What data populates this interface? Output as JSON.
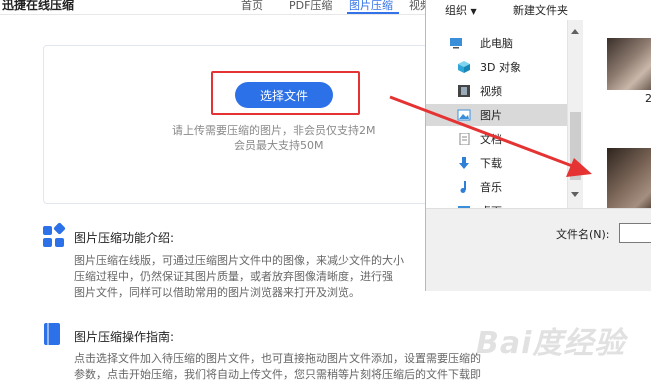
{
  "site": {
    "brand": "迅捷在线压缩",
    "nav": [
      "首页",
      "PDF压缩",
      "图片压缩",
      "视频"
    ],
    "active_nav": "图片压缩"
  },
  "upload": {
    "button_label": "选择文件",
    "hint_line1": "请上传需要压缩的图片，非会员仅支持2M",
    "hint_line2": "会员最大支持50M"
  },
  "sections": [
    {
      "title": "图片压缩功能介绍:",
      "lines": [
        "图片压缩在线版，可通过压缩图片文件中的图像，来减少文件的大小",
        "压缩过程中，仍然保证其图片质量，或者放弃图像清晰度，进行强",
        "图片文件，同样可以借助常用的图片浏览器来打开及浏览。"
      ]
    },
    {
      "title": "图片压缩操作指南:",
      "lines": [
        "点击选择文件加入待压缩的图片文件，也可直接拖动图片文件添加，设置需要压缩的",
        "参数，点击开始压缩，我们将自动上传文件，您只需稍等片刻将压缩后的文件下载即"
      ]
    }
  ],
  "dialog": {
    "organize_label": "组织",
    "new_folder_label": "新建文件夹",
    "nav_items": [
      {
        "label": "此电脑",
        "icon": "pc-icon"
      },
      {
        "label": "3D 对象",
        "icon": "cube-icon"
      },
      {
        "label": "视频",
        "icon": "video-icon"
      },
      {
        "label": "图片",
        "icon": "picture-icon",
        "selected": true
      },
      {
        "label": "文档",
        "icon": "document-icon"
      },
      {
        "label": "下载",
        "icon": "download-icon"
      },
      {
        "label": "音乐",
        "icon": "music-icon"
      },
      {
        "label": "桌面",
        "icon": "desktop-icon"
      }
    ],
    "thumb_label": "2",
    "filename_label": "文件名(N):",
    "filename_value": ""
  },
  "watermark": "Bai度经验",
  "colors": {
    "accent": "#2c71e7",
    "annotation_red": "#e53333"
  }
}
